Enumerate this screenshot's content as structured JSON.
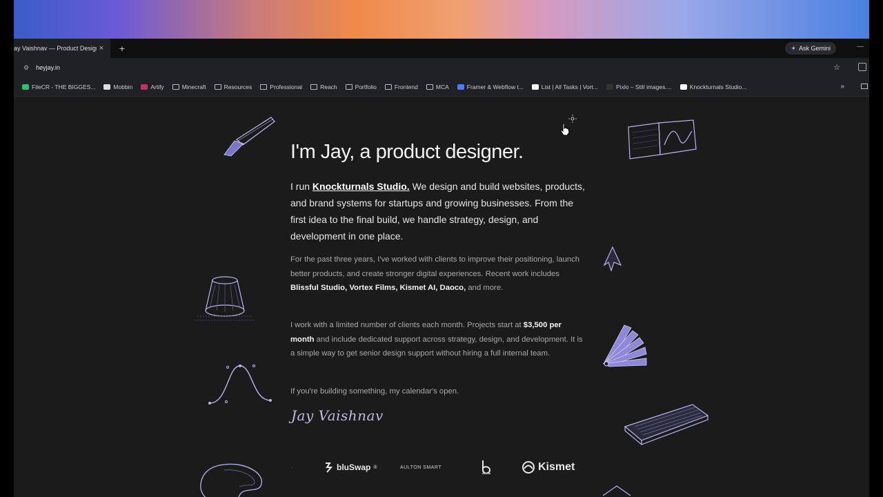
{
  "browser": {
    "tab_title": "ay Vaishnav — Product Design",
    "tab_close": "×",
    "new_tab": "+",
    "gemini_label": "Ask Gemini",
    "window_min": "—",
    "url": "heyjay.in",
    "bookmarks": [
      {
        "label": "FileCR - THE BIGGES...",
        "icon": "filecr-favicon",
        "color": "#2fbf71"
      },
      {
        "label": "Mobbin",
        "icon": "mobbin-favicon",
        "color": "#dddddd"
      },
      {
        "label": "Artify",
        "icon": "artify-favicon",
        "color": "#c0306a"
      },
      {
        "label": "Minecraft",
        "icon": "folder-icon"
      },
      {
        "label": "Resources",
        "icon": "folder-icon"
      },
      {
        "label": "Professional",
        "icon": "folder-icon"
      },
      {
        "label": "Reach",
        "icon": "folder-icon"
      },
      {
        "label": "Portfolio",
        "icon": "folder-icon"
      },
      {
        "label": "Frontend",
        "icon": "folder-icon"
      },
      {
        "label": "MCA",
        "icon": "folder-icon"
      },
      {
        "label": "Framer & Webflow t...",
        "icon": "framer-favicon",
        "color": "#4a7cff"
      },
      {
        "label": "List | All Tasks | Vort...",
        "icon": "tasks-favicon",
        "color": "#ffffff"
      },
      {
        "label": "Pixlo – Still images....",
        "icon": "pixlo-favicon",
        "color": "#333333"
      },
      {
        "label": "Knockturnals Studio...",
        "icon": "knockturnals-favicon",
        "color": "#ffffff"
      }
    ],
    "bookmarks_more": "»"
  },
  "page": {
    "heading": "I'm Jay, a product designer.",
    "lead_prefix": "I run ",
    "studio_link": "Knockturnals Studio.",
    "lead_rest": " We design and build websites, products, and brand systems for startups and growing businesses. From the first idea to the final build, we handle strategy, design, and development in one place.",
    "p1_text": "For the past three years, I've worked with clients to improve their positioning, launch better products, and create stronger digital experiences. Recent work includes ",
    "p1_bold": "Blissful Studio, Vortex Films, Kismet AI, Daoco,",
    "p1_tail": " and more.",
    "p2_text": "I work with a limited number of clients each month. Projects start at ",
    "p2_bold": "$3,500 per month",
    "p2_tail": " and include dedicated support across strategy, design, and development. It is a simple way to get senior design support without hiring a full internal team.",
    "p3_text": "If you're building something, my calendar's open.",
    "signature": "Jay Vaishnav",
    "logos": {
      "blu": "bluSwap",
      "blu_sup": "®",
      "aulton": "AULTON SMART",
      "kismet": "Kismet"
    }
  },
  "colors": {
    "page_bg": "#1b1b1b",
    "illustration": "#b9b6f0",
    "accent_fill": "#7a76c8"
  }
}
